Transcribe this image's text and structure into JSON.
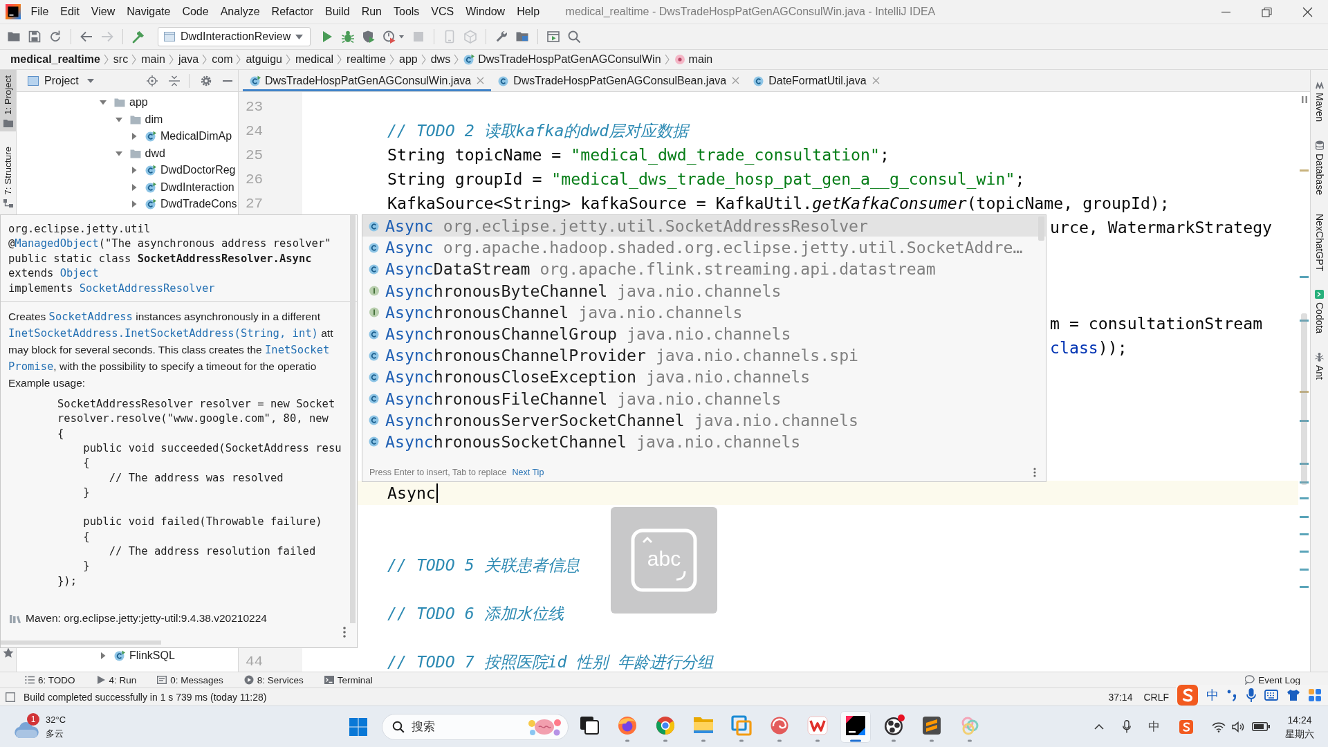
{
  "window": {
    "title": "medical_realtime - DwsTradeHospPatGenAGConsulWin.java - IntelliJ IDEA"
  },
  "menu": [
    "File",
    "Edit",
    "View",
    "Navigate",
    "Code",
    "Analyze",
    "Refactor",
    "Build",
    "Run",
    "Tools",
    "VCS",
    "Window",
    "Help"
  ],
  "toolbar": {
    "left_groups": [
      [
        {
          "kind": "open",
          "disabled": false
        },
        {
          "kind": "save",
          "disabled": false
        },
        {
          "kind": "sync",
          "disabled": false
        }
      ],
      [
        {
          "kind": "back",
          "disabled": false
        },
        {
          "kind": "forward",
          "disabled": true
        }
      ],
      [
        {
          "kind": "build",
          "disabled": false
        }
      ]
    ],
    "run_configuration": "DwdInteractionReview",
    "right_groups": [
      [
        {
          "kind": "run",
          "disabled": false
        },
        {
          "kind": "debug",
          "disabled": false
        },
        {
          "kind": "coverage",
          "disabled": false
        },
        {
          "kind": "profile",
          "disabled": false
        },
        {
          "kind": "stop",
          "disabled": true
        }
      ],
      [
        {
          "kind": "device",
          "disabled": true
        },
        {
          "kind": "package",
          "disabled": true
        }
      ],
      [
        {
          "kind": "wrench",
          "disabled": false
        },
        {
          "kind": "structure",
          "disabled": false
        }
      ],
      [
        {
          "kind": "window",
          "disabled": false
        },
        {
          "kind": "search",
          "disabled": false
        }
      ]
    ]
  },
  "breadcrumbs": [
    {
      "kind": "project",
      "label": "medical_realtime"
    },
    {
      "kind": "folder",
      "label": "src"
    },
    {
      "kind": "folder",
      "label": "main"
    },
    {
      "kind": "folder",
      "label": "java"
    },
    {
      "kind": "folder",
      "label": "com"
    },
    {
      "kind": "folder",
      "label": "atguigu"
    },
    {
      "kind": "folder",
      "label": "medical"
    },
    {
      "kind": "folder",
      "label": "realtime"
    },
    {
      "kind": "folder",
      "label": "app"
    },
    {
      "kind": "folder",
      "label": "dws"
    },
    {
      "kind": "runnable",
      "label": "DwsTradeHospPatGenAGConsulWin"
    },
    {
      "kind": "method",
      "label": "main"
    }
  ],
  "left_strip": [
    {
      "kind": "project",
      "label": "1: Project",
      "selected": true
    },
    {
      "kind": "structure",
      "label": "7: Structure",
      "selected": false
    }
  ],
  "project_panel": {
    "title": "Project",
    "tree": [
      {
        "kind": "folder",
        "label": "app",
        "expanded": true,
        "children": [
          {
            "kind": "folder",
            "label": "dim",
            "expanded": true,
            "children": [
              {
                "kind": "runnable",
                "label": "MedicalDimAp",
                "expanded": false
              }
            ]
          },
          {
            "kind": "folder",
            "label": "dwd",
            "expanded": true,
            "children": [
              {
                "kind": "runnable",
                "label": "DwdDoctorReg",
                "expanded": false
              },
              {
                "kind": "runnable",
                "label": "DwdInteraction",
                "expanded": false
              },
              {
                "kind": "runnable",
                "label": "DwdTradeCons",
                "expanded": false
              }
            ]
          }
        ]
      },
      {
        "kind": "runnable",
        "label": "FlinkSQL",
        "expanded": false
      }
    ]
  },
  "editor_tabs": [
    {
      "kind": "runnable",
      "label": "DwsTradeHospPatGenAGConsulWin.java",
      "selected": true
    },
    {
      "kind": "class",
      "label": "DwsTradeHospPatGenAGConsulBean.java",
      "selected": false
    },
    {
      "kind": "class",
      "label": "DateFormatUtil.java",
      "selected": false
    }
  ],
  "editor": {
    "lines": [
      {
        "kind": "blank",
        "number": "23"
      },
      {
        "kind": "code",
        "number": "24",
        "tokens": [
          {
            "kind": "comment",
            "text": "// TODO 2 读取kafka的dwd层对应数据"
          }
        ]
      },
      {
        "kind": "code",
        "number": "25",
        "tokens": [
          {
            "kind": "plain",
            "text": "String topicName = "
          },
          {
            "kind": "string",
            "text": "\"medical_dwd_trade_consultation\""
          },
          {
            "kind": "plain",
            "text": ";"
          }
        ]
      },
      {
        "kind": "code",
        "number": "26",
        "tokens": [
          {
            "kind": "plain",
            "text": "String groupId = "
          },
          {
            "kind": "string",
            "text": "\"medical_dws_trade_hosp_pat_gen_a__g_consul_win\""
          },
          {
            "kind": "plain",
            "text": ";"
          }
        ]
      },
      {
        "kind": "code",
        "number": "27",
        "tokens": [
          {
            "kind": "plain",
            "text": "KafkaSource<String> kafkaSource = KafkaUtil."
          },
          {
            "kind": "static",
            "text": "getKafkaConsumer"
          },
          {
            "kind": "plain",
            "text": "(topicName, groupId);"
          }
        ]
      },
      {
        "kind": "after_popup",
        "tokens": [
          {
            "kind": "plain",
            "text": "urce, WatermarkStrategy"
          }
        ]
      },
      {
        "kind": "blank"
      },
      {
        "kind": "blank"
      },
      {
        "kind": "blank"
      },
      {
        "kind": "after_popup",
        "tokens": [
          {
            "kind": "plain",
            "text": "m = consultationStream"
          }
        ]
      },
      {
        "kind": "after_popup",
        "tokens": [
          {
            "kind": "keyword",
            "text": "class"
          },
          {
            "kind": "plain",
            "text": "));"
          }
        ]
      },
      {
        "kind": "blank"
      },
      {
        "kind": "blank"
      },
      {
        "kind": "blank"
      },
      {
        "kind": "blank"
      },
      {
        "kind": "blank"
      },
      {
        "kind": "current",
        "tokens": [
          {
            "kind": "plain",
            "text": "Async"
          }
        ]
      },
      {
        "kind": "blank"
      },
      {
        "kind": "blank"
      },
      {
        "kind": "code",
        "tokens": [
          {
            "kind": "comment",
            "text": "// TODO 5 关联患者信息"
          }
        ]
      },
      {
        "kind": "blank"
      },
      {
        "kind": "code",
        "tokens": [
          {
            "kind": "comment",
            "text": "// TODO 6 添加水位线"
          }
        ]
      },
      {
        "kind": "blank"
      },
      {
        "kind": "code",
        "number": "44",
        "tokens": [
          {
            "kind": "comment",
            "text": "// TODO 7 按照医院id 性别 年龄进行分组"
          }
        ]
      }
    ]
  },
  "completion": {
    "items": [
      {
        "kind": "class",
        "matched": "Async",
        "package": "org.eclipse.jetty.util.SocketAddressResolver",
        "selected": true
      },
      {
        "kind": "class",
        "matched": "Async",
        "package": "org.apache.hadoop.shaded.org.eclipse.jetty.util.SocketAddre…",
        "selected": false
      },
      {
        "kind": "class",
        "matched": "Async",
        "rest": "DataStream",
        "package": "org.apache.flink.streaming.api.datastream",
        "selected": false
      },
      {
        "kind": "interface",
        "matched": "Async",
        "rest": "hronousByteChannel",
        "package": "java.nio.channels",
        "selected": false
      },
      {
        "kind": "interface",
        "matched": "Async",
        "rest": "hronousChannel",
        "package": "java.nio.channels",
        "selected": false
      },
      {
        "kind": "class",
        "matched": "Async",
        "rest": "hronousChannelGroup",
        "package": "java.nio.channels",
        "selected": false
      },
      {
        "kind": "class",
        "matched": "Async",
        "rest": "hronousChannelProvider",
        "package": "java.nio.channels.spi",
        "selected": false
      },
      {
        "kind": "class",
        "matched": "Async",
        "rest": "hronousCloseException",
        "package": "java.nio.channels",
        "selected": false
      },
      {
        "kind": "class",
        "matched": "Async",
        "rest": "hronousFileChannel",
        "package": "java.nio.channels",
        "selected": false
      },
      {
        "kind": "class",
        "matched": "Async",
        "rest": "hronousServerSocketChannel",
        "package": "java.nio.channels",
        "selected": false
      },
      {
        "kind": "class",
        "matched": "Async",
        "rest": "hronousSocketChannel",
        "package": "java.nio.channels",
        "selected": false
      }
    ],
    "hint": "Press Enter to insert, Tab to replace",
    "tip_link": "Next Tip"
  },
  "documentation": {
    "signature": [
      [
        {
          "kind": "plain",
          "text": "org.eclipse.jetty.util"
        }
      ],
      [
        {
          "kind": "plain",
          "text": "@"
        },
        {
          "kind": "link",
          "text": "ManagedObject"
        },
        {
          "kind": "plain",
          "text": "(\"The asynchronous address resolver\""
        }
      ],
      [
        {
          "kind": "plain",
          "text": "public static class "
        },
        {
          "kind": "bold",
          "text": "SocketAddressResolver.Async"
        }
      ],
      [
        {
          "kind": "plain",
          "text": "extends "
        },
        {
          "kind": "link",
          "text": "Object"
        }
      ],
      [
        {
          "kind": "plain",
          "text": "implements "
        },
        {
          "kind": "link",
          "text": "SocketAddressResolver"
        }
      ]
    ],
    "description": [
      [
        {
          "kind": "text",
          "text": "Creates "
        },
        {
          "kind": "code_link",
          "text": "SocketAddress"
        },
        {
          "kind": "text",
          "text": " instances asynchronously in a different"
        }
      ],
      [
        {
          "kind": "code_link",
          "text": "InetSocketAddress.InetSocketAddress(String, int)"
        },
        {
          "kind": "text",
          "text": " att"
        }
      ],
      [
        {
          "kind": "text",
          "text": "may block for several seconds. This class creates the "
        },
        {
          "kind": "code_link",
          "text": "InetSocket"
        }
      ],
      [
        {
          "kind": "code_link",
          "text": "Promise"
        },
        {
          "kind": "text",
          "text": ", with the possibility to specify a timeout for the operatio"
        }
      ],
      [
        {
          "kind": "text",
          "text": "Example usage:"
        }
      ]
    ],
    "example_code": "SocketAddressResolver resolver = new Socket\nresolver.resolve(\"www.google.com\", 80, new\n{\n    public void succeeded(SocketAddress resu\n    {\n        // The address was resolved\n    }\n\n    public void failed(Throwable failure)\n    {\n        // The address resolution failed\n    }\n});",
    "source": "Maven: org.eclipse.jetty:jetty-util:9.4.38.v20210224"
  },
  "input_mode_indicator": {
    "label": "abc"
  },
  "right_strip": [
    {
      "kind": "maven",
      "label": "Maven"
    },
    {
      "kind": "database",
      "label": "Database"
    },
    {
      "kind": "plain",
      "label": "NexChatGPT"
    },
    {
      "kind": "codota",
      "label": "Codota"
    },
    {
      "kind": "ant",
      "label": "Ant"
    }
  ],
  "tool_windows": [
    {
      "kind": "todo",
      "label": "6: TODO"
    },
    {
      "kind": "run",
      "label": "4: Run"
    },
    {
      "kind": "messages",
      "label": "0: Messages"
    },
    {
      "kind": "services",
      "label": "8: Services"
    },
    {
      "kind": "terminal",
      "label": "Terminal"
    }
  ],
  "event_log": "Event Log",
  "status_bar": {
    "message": "Build completed successfully in 1 s 739 ms (today 11:28)",
    "caret_position": "37:14",
    "line_separator": "CRLF"
  },
  "ime_toolbar": {
    "mode": "中"
  },
  "taskbar": {
    "weather": {
      "badge": "1",
      "temperature": "32°C",
      "condition": "多云"
    },
    "search": {
      "placeholder": "搜索"
    },
    "apps": [
      {
        "kind": "task_view",
        "running": false,
        "selected": false
      },
      {
        "kind": "orange_browser",
        "running": true,
        "selected": false
      },
      {
        "kind": "ring_browser",
        "running": true,
        "selected": false
      },
      {
        "kind": "folder",
        "running": true,
        "selected": false
      },
      {
        "kind": "squares",
        "running": true,
        "selected": false
      },
      {
        "kind": "red_swirl",
        "running": true,
        "selected": false
      },
      {
        "kind": "red_w",
        "running": true,
        "selected": false
      },
      {
        "kind": "ide",
        "running": true,
        "selected": true
      },
      {
        "kind": "record",
        "running": true,
        "selected": false
      },
      {
        "kind": "dark_tile",
        "running": true,
        "selected": false
      },
      {
        "kind": "pastel_rings",
        "running": true,
        "selected": false
      }
    ],
    "tray": {
      "input_method": "中",
      "time": "14:24",
      "day": "星期六"
    }
  }
}
